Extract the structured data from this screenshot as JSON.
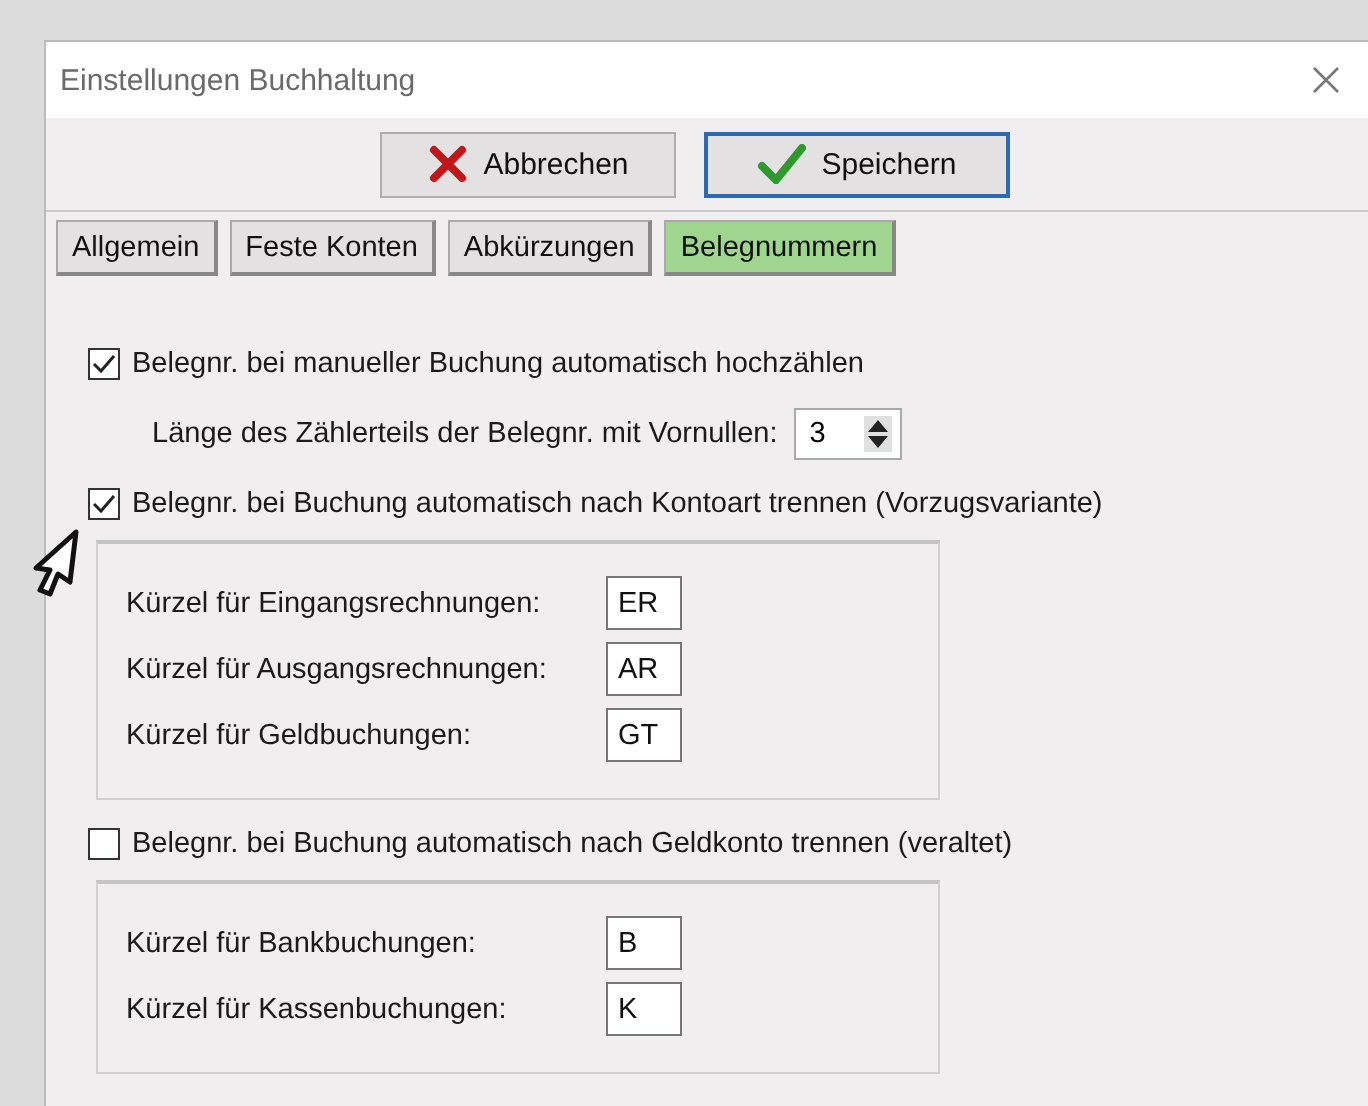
{
  "window": {
    "title": "Einstellungen Buchhaltung"
  },
  "buttons": [
    {
      "label": "Abbrechen",
      "kind": "cancel",
      "focused": false
    },
    {
      "label": "Speichern",
      "kind": "save",
      "focused": true
    }
  ],
  "tabs": [
    {
      "label": "Allgemein",
      "selected": false
    },
    {
      "label": "Feste Konten",
      "selected": false
    },
    {
      "label": "Abkürzungen",
      "selected": false
    },
    {
      "label": "Belegnummern",
      "selected": true
    }
  ],
  "settings": [
    {
      "kind": "checkbox",
      "label": "Belegnr. bei manueller Buchung automatisch hochzählen",
      "checked": true
    },
    {
      "kind": "spinner",
      "label": "Länge des Zählerteils der Belegnr. mit Vornullen:",
      "value": "3"
    },
    {
      "kind": "checkbox",
      "label": "Belegnr. bei Buchung automatisch nach Kontoart trennen (Vorzugsvariante)",
      "checked": true
    },
    {
      "kind": "group",
      "fields": [
        {
          "label": "Kürzel für Eingangsrechnungen:",
          "value": "ER"
        },
        {
          "label": "Kürzel für Ausgangsrechnungen:",
          "value": "AR"
        },
        {
          "label": "Kürzel für Geldbuchungen:",
          "value": "GT"
        }
      ]
    },
    {
      "kind": "checkbox",
      "label": "Belegnr. bei Buchung automatisch nach Geldkonto trennen (veraltet)",
      "checked": false
    },
    {
      "kind": "group",
      "fields": [
        {
          "label": "Kürzel für Bankbuchungen:",
          "value": "B"
        },
        {
          "label": "Kürzel für Kassenbuchungen:",
          "value": "K"
        }
      ]
    }
  ]
}
